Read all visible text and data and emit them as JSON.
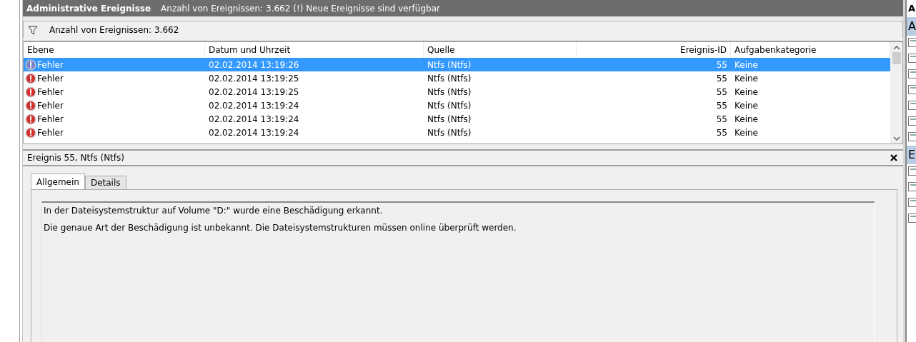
{
  "header": {
    "title": "Administrative Ereignisse",
    "subtitle": "Anzahl von Ereignissen: 3.662 (!) Neue Ereignisse sind verfügbar"
  },
  "filter_bar": {
    "text": "Anzahl von Ereignissen: 3.662"
  },
  "table": {
    "columns": [
      {
        "label": "Ebene",
        "kind": "text"
      },
      {
        "label": "Datum und Uhrzeit",
        "kind": "text"
      },
      {
        "label": "Quelle",
        "kind": "text"
      },
      {
        "label": "Ereignis-ID",
        "kind": "number"
      },
      {
        "label": "Aufgabenkategorie",
        "kind": "text"
      }
    ],
    "rows": [
      {
        "selected": true,
        "kind": "error",
        "cells": [
          "Fehler",
          "02.02.2014 13:19:26",
          "Ntfs (Ntfs)",
          "55",
          "Keine"
        ]
      },
      {
        "selected": false,
        "kind": "error",
        "cells": [
          "Fehler",
          "02.02.2014 13:19:25",
          "Ntfs (Ntfs)",
          "55",
          "Keine"
        ]
      },
      {
        "selected": false,
        "kind": "error",
        "cells": [
          "Fehler",
          "02.02.2014 13:19:25",
          "Ntfs (Ntfs)",
          "55",
          "Keine"
        ]
      },
      {
        "selected": false,
        "kind": "error",
        "cells": [
          "Fehler",
          "02.02.2014 13:19:24",
          "Ntfs (Ntfs)",
          "55",
          "Keine"
        ]
      },
      {
        "selected": false,
        "kind": "error",
        "cells": [
          "Fehler",
          "02.02.2014 13:19:24",
          "Ntfs (Ntfs)",
          "55",
          "Keine"
        ]
      },
      {
        "selected": false,
        "kind": "error",
        "cells": [
          "Fehler",
          "02.02.2014 13:19:24",
          "Ntfs (Ntfs)",
          "55",
          "Keine"
        ]
      }
    ]
  },
  "detail": {
    "title": "Ereignis 55, Ntfs (Ntfs)",
    "tabs": [
      {
        "label": "Allgemein",
        "selected": true
      },
      {
        "label": "Details",
        "selected": false
      }
    ],
    "paragraphs": [
      "In der Dateisystemstruktur auf Volume \"D:\" wurde eine Beschädigung erkannt.",
      "Die genaue Art der Beschädigung ist unbekannt. Die Dateisystemstrukturen müssen online überprüft werden."
    ]
  },
  "actions_pane": {
    "items": [
      {
        "label": "A",
        "kind": "title"
      },
      {
        "label": "A",
        "kind": "section"
      },
      {
        "kind": "icon"
      },
      {
        "kind": "icon"
      },
      {
        "kind": "icon"
      },
      {
        "kind": "icon"
      },
      {
        "kind": "icon"
      },
      {
        "kind": "icon"
      },
      {
        "kind": "icon"
      },
      {
        "label": "E",
        "kind": "section"
      },
      {
        "kind": "icon"
      },
      {
        "kind": "icon"
      },
      {
        "kind": "icon"
      },
      {
        "kind": "icon"
      }
    ]
  }
}
